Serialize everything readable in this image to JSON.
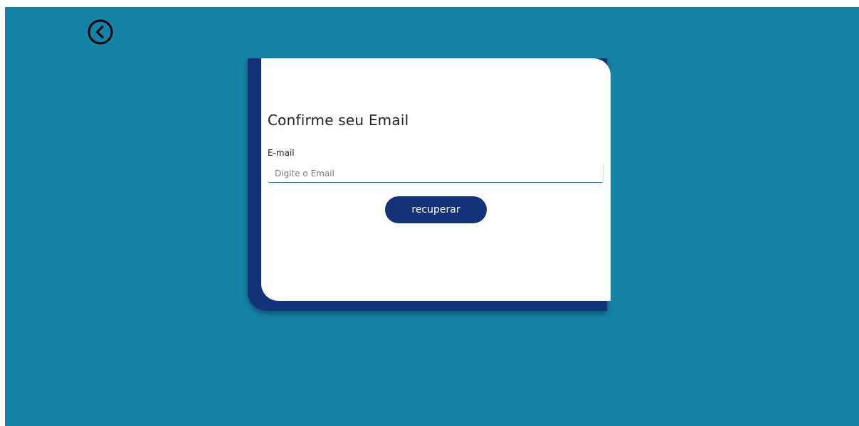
{
  "navigation": {
    "back_icon": "chevron-left-circle-icon"
  },
  "form": {
    "title": "Confirme seu Email",
    "email_label": "E-mail",
    "email_placeholder": "Digite o Email",
    "email_value": "",
    "submit_label": "recuperar"
  },
  "colors": {
    "background": "#1583a5",
    "accent": "#12327a",
    "card": "#ffffff"
  }
}
